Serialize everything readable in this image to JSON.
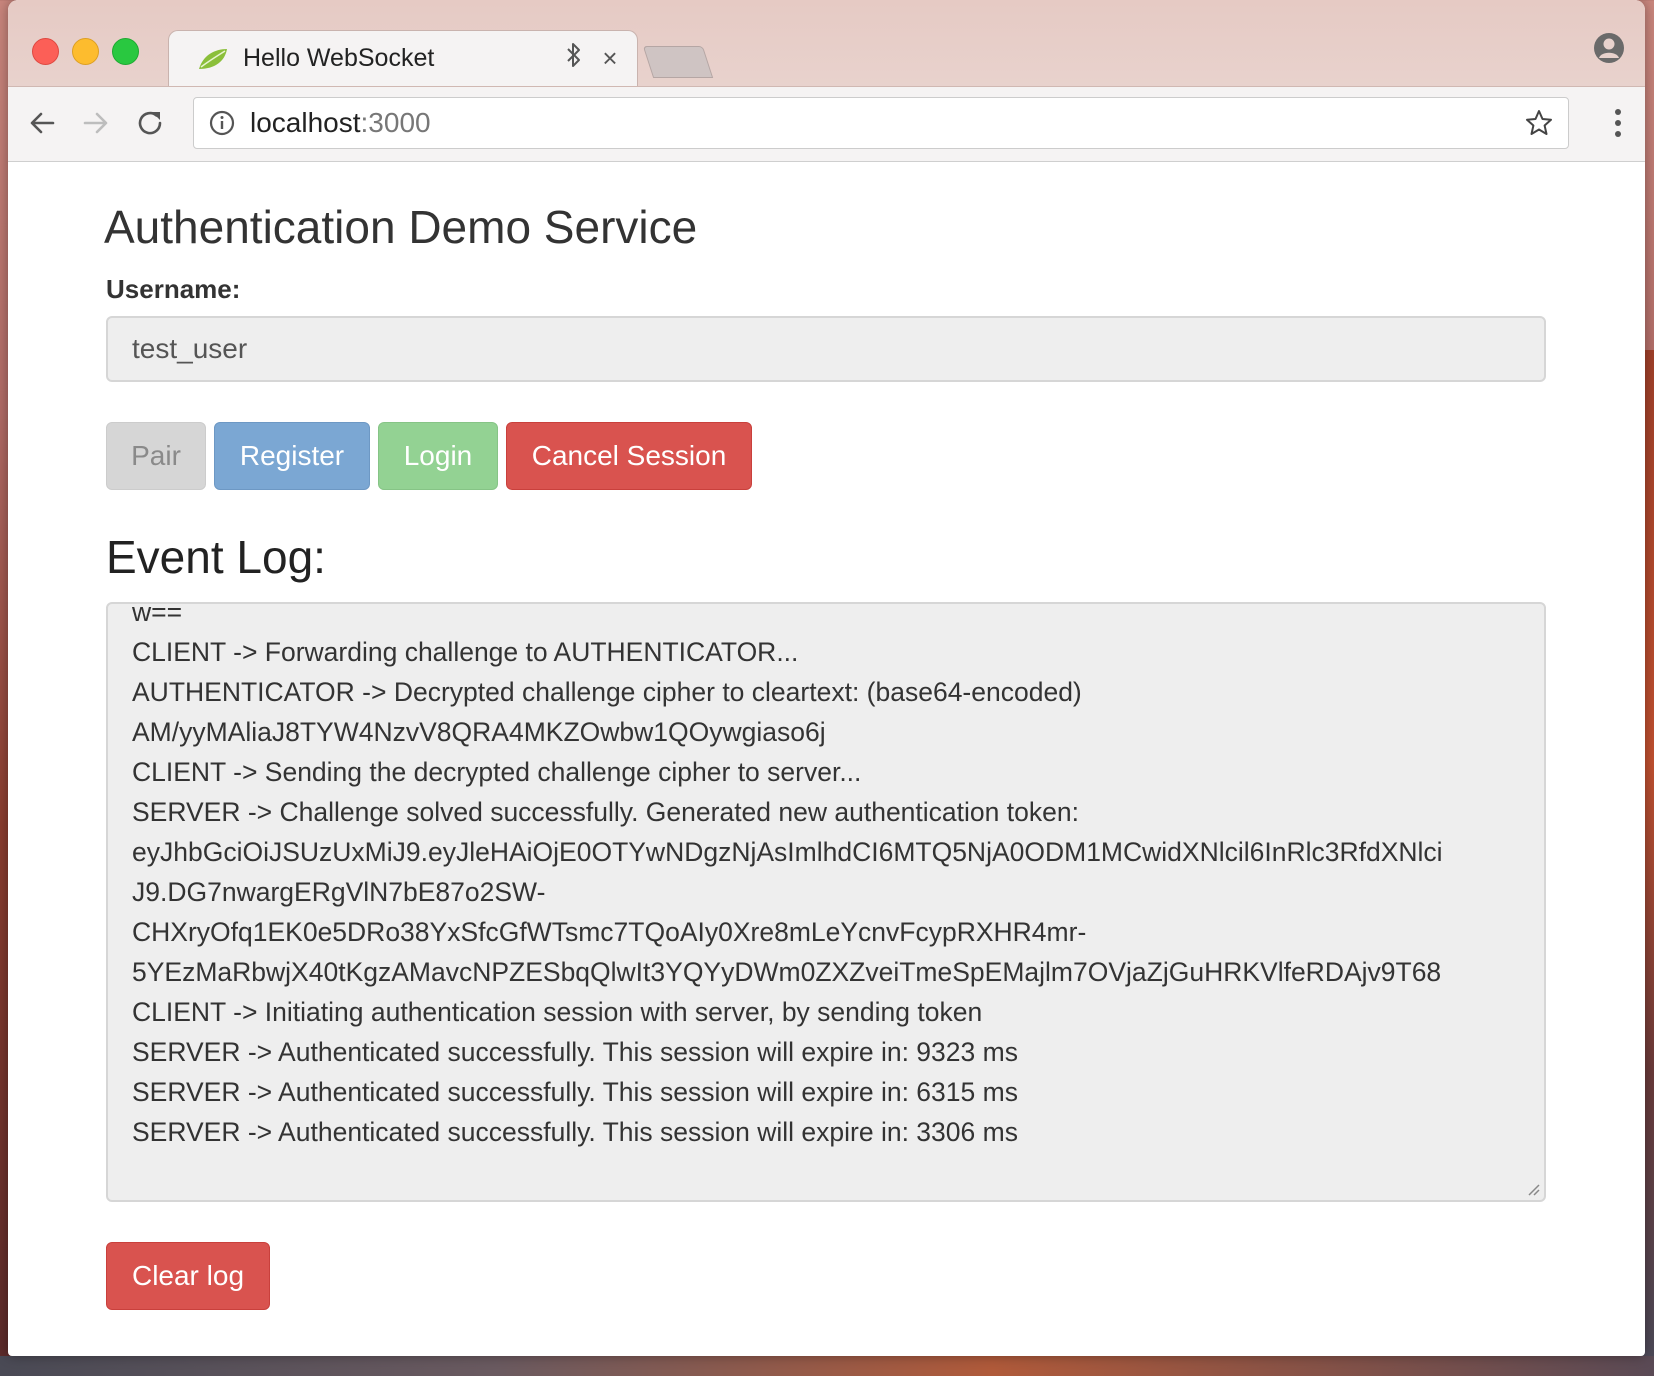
{
  "browser": {
    "tab_title": "Hello WebSocket",
    "url_host": "localhost",
    "url_port": ":3000",
    "icons": [
      "spring-leaf-icon",
      "bluetooth-icon",
      "close-icon",
      "profile-icon",
      "back-arrow-icon",
      "forward-arrow-icon",
      "reload-icon",
      "info-icon",
      "star-icon",
      "menu-dots-icon"
    ]
  },
  "page": {
    "title": "Authentication Demo Service",
    "username_label": "Username:",
    "username_value": "test_user",
    "buttons": {
      "pair": "Pair",
      "register": "Register",
      "login": "Login",
      "cancel_session": "Cancel Session",
      "clear_log": "Clear log"
    },
    "event_log_title": "Event Log:",
    "event_log_lines": [
      "w==",
      "CLIENT -> Forwarding challenge to AUTHENTICATOR...",
      "AUTHENTICATOR -> Decrypted challenge cipher to cleartext: (base64-encoded)",
      "AM/yyMAliaJ8TYW4NzvV8QRA4MKZOwbw1QOywgiaso6j",
      "CLIENT -> Sending the decrypted challenge cipher to server...",
      "SERVER -> Challenge solved successfully. Generated new authentication token:",
      "eyJhbGciOiJSUzUxMiJ9.eyJleHAiOjE0OTYwNDgzNjAsImlhdCI6MTQ5NjA0ODM1MCwidXNlcil6InRlc3RfdXNlci",
      "J9.DG7nwargERgVlN7bE87o2SW-",
      "CHXryOfq1EK0e5DRo38YxSfcGfWTsmc7TQoAIy0Xre8mLeYcnvFcypRXHR4mr-",
      "5YEzMaRbwjX40tKgzAMavcNPZESbqQlwIt3YQYyDWm0ZXZveiTmeSpEMajlm7OVjaZjGuHRKVlfeRDAjv9T68",
      "CLIENT -> Initiating authentication session with server, by sending token",
      "SERVER -> Authenticated successfully. This session will expire in: 9323 ms",
      "SERVER -> Authenticated successfully. This session will expire in: 6315 ms",
      "SERVER -> Authenticated successfully. This session will expire in: 3306 ms"
    ]
  },
  "colors": {
    "primary_blue": "#7ba7d3",
    "success_green": "#93d293",
    "danger_red": "#d9534f",
    "disabled_gray": "#d6d6d6"
  }
}
